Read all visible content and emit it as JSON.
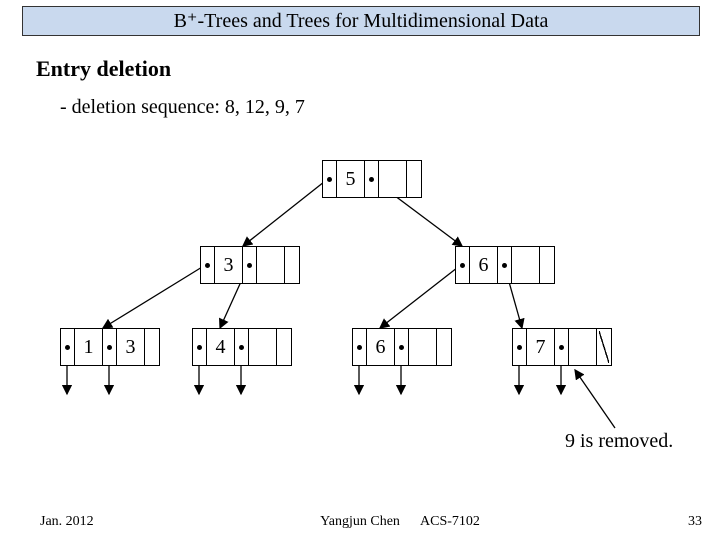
{
  "title": "B⁺-Trees and Trees for Multidimensional Data",
  "section": "Entry deletion",
  "subline": "- deletion sequence: 8, 12, 9, 7",
  "nodes": {
    "root": {
      "keys": [
        "5",
        ""
      ]
    },
    "mid_l": {
      "keys": [
        "3",
        ""
      ]
    },
    "mid_r": {
      "keys": [
        "6",
        ""
      ]
    },
    "leaf0": {
      "keys": [
        "1",
        "3"
      ]
    },
    "leaf1": {
      "keys": [
        "4",
        ""
      ]
    },
    "leaf2": {
      "keys": [
        "6",
        ""
      ]
    },
    "leaf3": {
      "keys": [
        "7",
        ""
      ]
    }
  },
  "annotation": "9 is removed.",
  "footer": {
    "date": "Jan. 2012",
    "author": "Yangjun Chen",
    "course": "ACS-7102",
    "page": "33"
  },
  "chart_data": {
    "type": "tree",
    "title": "B+-tree after removing 9 (deletion sequence 8,12,9,7)",
    "nodes": [
      {
        "id": "root",
        "level": 0,
        "keys": [
          5
        ],
        "children": [
          "mid_l",
          "mid_r"
        ]
      },
      {
        "id": "mid_l",
        "level": 1,
        "keys": [
          3
        ],
        "children": [
          "leaf0",
          "leaf1"
        ]
      },
      {
        "id": "mid_r",
        "level": 1,
        "keys": [
          6
        ],
        "children": [
          "leaf2",
          "leaf3"
        ]
      },
      {
        "id": "leaf0",
        "level": 2,
        "keys": [
          1,
          3
        ],
        "next": "leaf1"
      },
      {
        "id": "leaf1",
        "level": 2,
        "keys": [
          4
        ],
        "next": "leaf2"
      },
      {
        "id": "leaf2",
        "level": 2,
        "keys": [
          6
        ],
        "next": "leaf3"
      },
      {
        "id": "leaf3",
        "level": 2,
        "keys": [
          7
        ],
        "next": null
      }
    ],
    "annotation": "9 is removed."
  }
}
